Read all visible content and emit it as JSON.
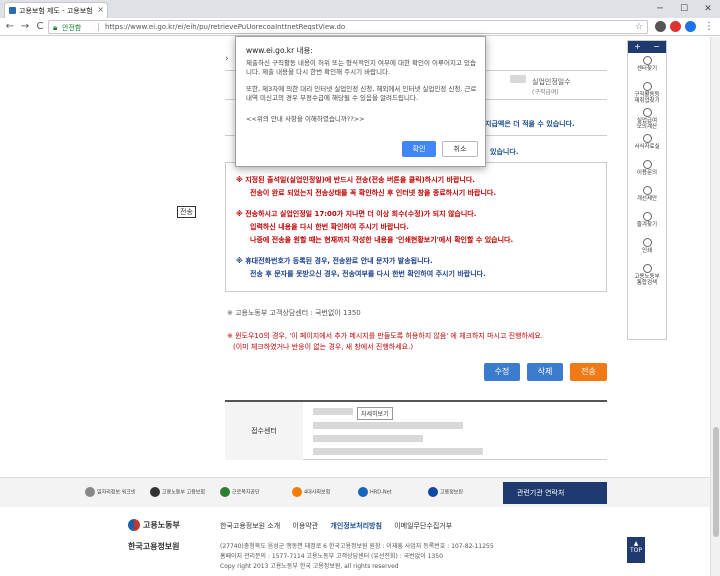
{
  "browser": {
    "tab_title": "고용보험 제도 - 고용보험",
    "tab_close": "×",
    "win_min": "─",
    "win_max": "☐",
    "win_close": "✕",
    "back": "←",
    "forward": "→",
    "reload": "C",
    "secure_label": "안전함",
    "url": "https://www.ei.go.kr/ei/eih/pu/retrievePuUorecoaInttnetReqstView.do",
    "star": "☆",
    "menu": "⋮"
  },
  "page": {
    "arrow": "›",
    "row_label": "실업인정일수",
    "row_label_sub": "(구직급여)",
    "blue_note": "지급액은 더 적을 수 있습니다.",
    "blue_note2": "있습니다.",
    "label_box": "전송",
    "notes": [
      {
        "text": "※ 지정된 출석일(실업인정일)에 반드시 전송(전송 버튼을 클릭)하시기 바랍니다.",
        "color": "red"
      },
      {
        "text": "전송이 완료 되었는지 전송상태를 꼭 확인하신 후 인터넷 창을 종료하시기 바랍니다.",
        "color": "red"
      },
      {
        "text": "※ 전송하시고 실업인정일 17:00가 지나면 더 이상 회수(수정)가 되지 않습니다.",
        "color": "red"
      },
      {
        "text": "입력하신 내용을 다시 한번 확인하여 주시기 바랍니다.",
        "color": "red"
      },
      {
        "text": "나중에 전송을 원할 때는 현재까지 작성한 내용을 '인쇄현황보기'에서 확인할 수 있습니다.",
        "color": "red"
      },
      {
        "text": "※ 휴대전화번호가 등록된 경우, 전송완료 안내 문자가 발송됩니다.",
        "color": "navy"
      },
      {
        "text": "전송 후 문자를 못받으신 경우, 전송여부를 다시 한번 확인하여 주시기 바랍니다.",
        "color": "navy"
      }
    ],
    "contact": "※ 고용노동부 고객상담센터 : 국번없이 1350",
    "warn1": "※ 윈도우10의 경우, '이 페이지에서 추가 메시지를 만들도록 허용하지 않음' 에 체크하지 마시고 진행하세요.",
    "warn2": "(이미 체크하였거나 반응이 없는 경우, 새 창에서 진행하세요.)",
    "btn_edit": "수정",
    "btn_delete": "삭제",
    "btn_send": "전송",
    "recv_label": "접수센터",
    "detail_btn": "자세히보기"
  },
  "quickmenu": {
    "head_plus": "+",
    "head_minus": "−",
    "items": [
      "센터찾기",
      "구직활동등\n재취업찾기",
      "실업급여\n모의계산",
      "서식자료실",
      "이용문의",
      "개선제안",
      "즐겨찾기",
      "인쇄",
      "고용노동부\n통합검색"
    ]
  },
  "footer": {
    "partners": [
      "일자리정보 워크넷",
      "고용노동부 고용보험",
      "근로복지공단",
      "4대사회보험",
      "HRD-Net",
      "고용정보원"
    ],
    "related": "관련기관 연락처",
    "logo1": "고용노동부",
    "logo2": "한국고용정보원",
    "links": [
      "한국고용정보원 소개",
      "이용약관",
      "개인정보처리방침",
      "이메일무단수집거부"
    ],
    "line1": "(27740)충청북도 음성군 맹동면 태정로 6 한국고용정보원  원장 : 이재흥  사업자 등록번호 : 107-82-11255",
    "line2": "홈페이지 관리문의 : 1577-7114  고용노동부 고객상담센터 (유선전화) : 국번없이 1350",
    "line3": "Copy right 2013 고용노동부 한국 고용정보원, all rights reserved",
    "top": "TOP"
  },
  "dialog": {
    "title": "www.ei.go.kr 내용:",
    "msg1": "제출하신 구직활동 내용이 허위 또는 형식적인지 여부에 대한 확인이 이루어지고 있습니다. 제출 내용을 다시 한번 확인해 주시기 바랍니다.",
    "msg2": "또한, 제3자에 의한 대리 인터넷 실업인정 신청, 해외에서 인터넷 실업인정 신청, 근로내역 미신고의 경우 부정수급에 해당될 수 있음을 알려드립니다.",
    "msg3": "<<위의 안내 사항을 이해하였습니까??>>",
    "ok": "확인",
    "cancel": "취소"
  }
}
